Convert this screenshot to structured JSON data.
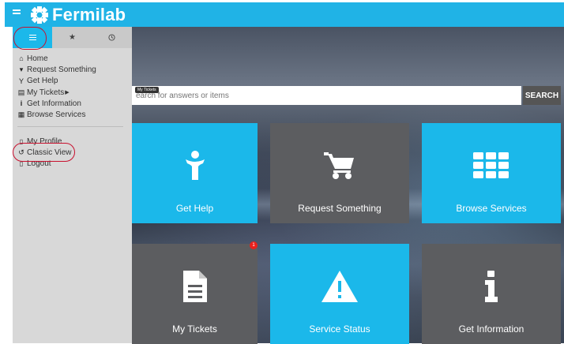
{
  "header": {
    "logo_text": "Fermilab"
  },
  "sidebar": {
    "tabs": [
      {
        "icon": "menu-icon"
      },
      {
        "icon": "star-icon"
      },
      {
        "icon": "clock-icon"
      }
    ],
    "items": [
      {
        "label": "Home",
        "icon": "home-icon"
      },
      {
        "label": "Request Something",
        "icon": "cart-icon"
      },
      {
        "label": "Get Help",
        "icon": "person-icon"
      },
      {
        "label": "My Tickets",
        "icon": "document-icon",
        "arrow": "▶"
      },
      {
        "label": "Get Information",
        "icon": "info-icon"
      },
      {
        "label": "Browse Services",
        "icon": "grid-icon"
      }
    ],
    "items2": [
      {
        "label": "My Profile",
        "icon": "profile-icon"
      },
      {
        "label": "Classic View",
        "icon": "history-icon"
      },
      {
        "label": "Logout",
        "icon": "logout-icon"
      }
    ]
  },
  "search": {
    "placeholder": "earch for answers or items",
    "button_label": "SEARCH",
    "tooltip": "My Tickets"
  },
  "tiles": [
    {
      "label": "Get Help",
      "color": "#1bb8ea",
      "icon": "person-icon"
    },
    {
      "label": "Request Something",
      "color": "#5c5d60",
      "icon": "cart-icon"
    },
    {
      "label": "Browse Services",
      "color": "#1bb8ea",
      "icon": "grid-icon"
    },
    {
      "label": "My Tickets",
      "color": "#5c5d60",
      "icon": "document-icon",
      "badge": "1"
    },
    {
      "label": "Service Status",
      "color": "#1bb8ea",
      "icon": "warning-icon"
    },
    {
      "label": "Get Information",
      "color": "#5c5d60",
      "icon": "info-icon"
    }
  ],
  "colors": {
    "accent": "#1bb8ea",
    "header": "#20b3e6",
    "tile_grey": "#5c5d60",
    "annotation": "#c8102e"
  }
}
